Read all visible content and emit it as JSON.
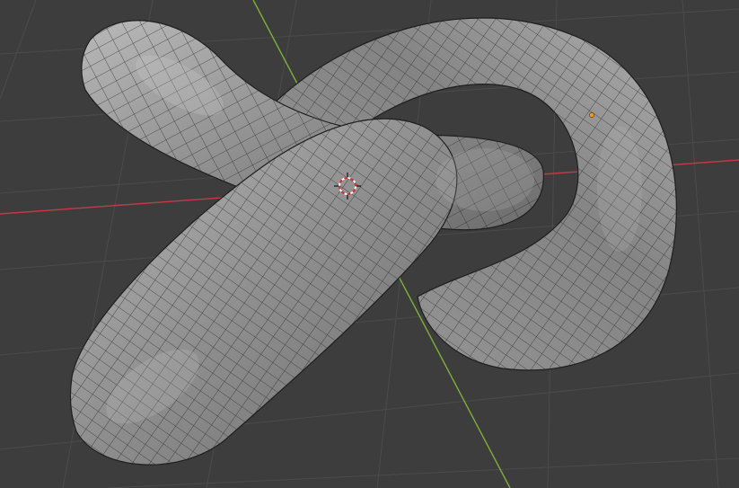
{
  "viewport": {
    "label": "",
    "shading_mode": "solid",
    "overlay": "wireframe"
  },
  "scene": {
    "object_type": "mesh",
    "object_shape": "knotted-tube",
    "active_element": "origin-point"
  },
  "colors": {
    "background": "#3d3d3d",
    "grid_line": "#4a4a4a",
    "x_axis": "#c23a48",
    "y_axis": "#7fae3c",
    "mesh_fill": "#8f8f8f",
    "mesh_light": "#b5b5b5",
    "mesh_dark": "#5a5a5a",
    "wire": "#1e1e1e",
    "cursor_ring_red": "#d12f2f",
    "cursor_ring_white": "#ffffff",
    "origin_dot": "#ff9a1f"
  }
}
